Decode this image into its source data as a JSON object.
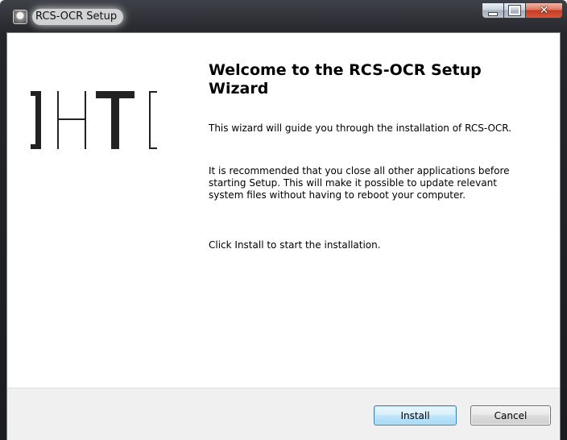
{
  "window": {
    "title": "RCS-OCR Setup",
    "icon": "installer-app-icon",
    "caption_buttons": {
      "minimize": "minimize-icon",
      "maximize": "maximize-icon",
      "close": "close-icon"
    }
  },
  "logo": {
    "text": "]HT[",
    "icon": "hacking-team-logo"
  },
  "content": {
    "heading": "Welcome to the RCS-OCR Setup Wizard",
    "paragraphs": [
      "This wizard will guide you through the installation of RCS-OCR.",
      "It is recommended that you close all other applications before starting Setup. This will make it possible to update relevant system files without having to reboot your computer.",
      "Click Install to start the installation."
    ]
  },
  "buttons": {
    "install": "Install",
    "cancel": "Cancel"
  },
  "colors": {
    "title_bar": "#24262b",
    "footer_bg": "#f0f0f0",
    "default_button_border": "#3c7fb1",
    "close_button": "#c43b24"
  }
}
